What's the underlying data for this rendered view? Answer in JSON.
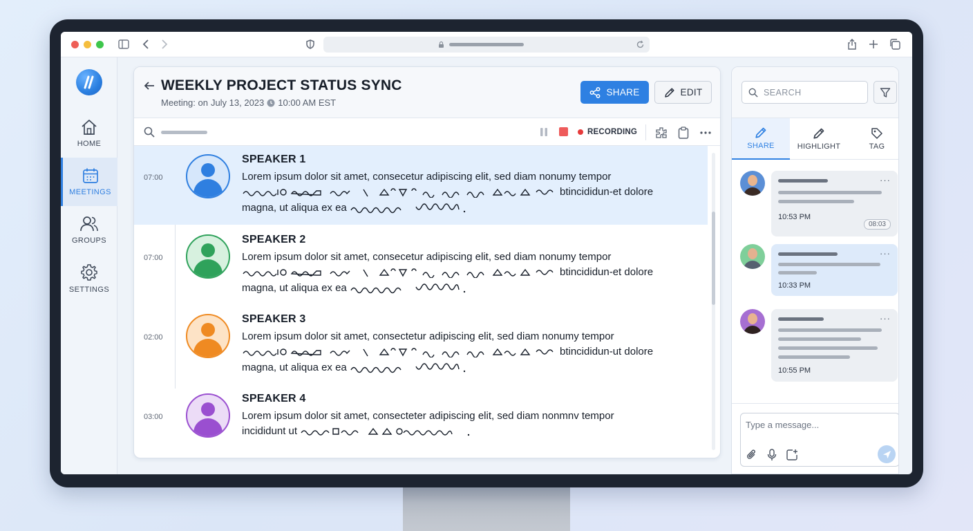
{
  "browser": {
    "url_placeholder": ""
  },
  "nav": {
    "items": [
      {
        "label": "HOME",
        "icon": "home-icon"
      },
      {
        "label": "MEETINGS",
        "icon": "calendar-icon"
      },
      {
        "label": "GROUPS",
        "icon": "users-icon"
      },
      {
        "label": "SETTINGS",
        "icon": "gear-icon"
      }
    ],
    "active": "MEETINGS"
  },
  "meeting": {
    "title": "WEEKLY PROJECT STATUS SYNC",
    "meeting_label": "Meeting: on",
    "date": "July 13, 2023",
    "time": "10:00 AM EST",
    "share_label": "SHARE",
    "edit_label": "EDIT"
  },
  "toolbar": {
    "recording_label": "RECORDING"
  },
  "transcript": [
    {
      "time": "07:00",
      "speaker": "SPEAKER 1",
      "line1": "Lorem ipsum dolor sit amet, consecetur adipiscing elit, sed diam nonumy tempor",
      "line2_tail": "btincididun-et dolore",
      "line3_start": "magna, ut aliqua ex ea",
      "color": "#2f7fe0",
      "bg": "#d6e7fb"
    },
    {
      "time": "07:00",
      "speaker": "SPEAKER 2",
      "line1": "Lorem ipsum dolor sit amet, consecetur adipiscing elit, sed diam nonumy tempor",
      "line2_tail": "btincididun-et dolore",
      "line3_start": "magna, ut aliqua ex ea",
      "color": "#2fa25b",
      "bg": "#d7f1df"
    },
    {
      "time": "02:00",
      "speaker": "SPEAKER 3",
      "line1": "Lorem ipsum dolor sit amet, consectetur adipiscing elit, sed diam nonumy tempor",
      "line2_tail": "btincididun-ut dolore",
      "line3_start": "magna, ut aliqua ex ea",
      "color": "#ef8a22",
      "bg": "#fde3c6"
    },
    {
      "time": "03:00",
      "speaker": "SPEAKER 4",
      "line1": "Lorem ipsum dolor sit amet, consecteter adipiscing elit, sed diam nonmnv tempor",
      "line2_tail": "",
      "line2_start": "incididunt ut",
      "color": "#9a4fd0",
      "bg": "#ecdcf7"
    }
  ],
  "right_panel": {
    "search_placeholder": "SEARCH",
    "tabs": [
      {
        "label": "SHARE",
        "icon": "pencil-icon"
      },
      {
        "label": "HIGHLIGHT",
        "icon": "highlight-pen-icon"
      },
      {
        "label": "TAG",
        "icon": "tag-icon"
      }
    ],
    "messages": [
      {
        "time": "10:53 PM",
        "duration": "08:03"
      },
      {
        "time": "10:33 PM"
      },
      {
        "time": "10:55 PM"
      }
    ],
    "composer_placeholder": "Type a message..."
  },
  "colors": {
    "accent": "#2e80e2",
    "recording": "#e63b3b"
  }
}
